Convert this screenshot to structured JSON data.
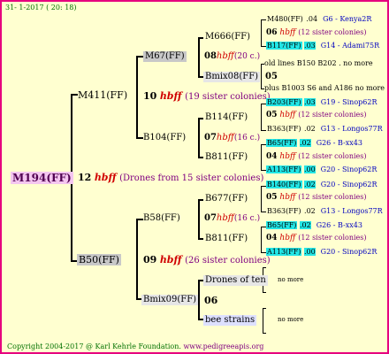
{
  "header": {
    "date": "31- 1-2017 ( 20: 18)"
  },
  "footer": {
    "copyright": "Copyright 2004-2017 @ Karl Kehrle Foundation.",
    "site": "www.pedigreeapis.org"
  },
  "root": {
    "name": "M194(FF)"
  },
  "gen1": {
    "num": "12",
    "hbff": "hbff",
    "note": "(Drones from 15 sister colonies)"
  },
  "sire": {
    "name": "M411(FF)",
    "num": "10",
    "hbff": "hbff",
    "note": "(19 sister colonies)"
  },
  "dam": {
    "name": "B50(FF)",
    "num": "09",
    "hbff": "hbff",
    "note": "(26 sister colonies)"
  },
  "m67": {
    "name": "M67(FF)",
    "num": "08",
    "hbff": "hbff",
    "note": "(20 c.)"
  },
  "b104": {
    "name": "B104(FF)",
    "num": "07",
    "hbff": "hbff",
    "note": "(16 c.)"
  },
  "b58": {
    "name": "B58(FF)",
    "num": "07",
    "hbff": "hbff",
    "note": "(16 c.)"
  },
  "bmix09": {
    "name": "Bmix09(FF)",
    "num": "06"
  },
  "m666": {
    "name": "M666(FF)",
    "num": "06",
    "hbff": "hbff",
    "note": "(12 sister colonies)"
  },
  "bmix08": {
    "name": "Bmix08(FF)",
    "num": "05"
  },
  "b114": {
    "name": "B114(FF)",
    "num": "05",
    "hbff": "hbff",
    "note": "(12 sister colonies)"
  },
  "b811a": {
    "name": "B811(FF)",
    "num": "04",
    "hbff": "hbff",
    "note": "(12 sister colonies)"
  },
  "b677": {
    "name": "B677(FF)",
    "num": "05",
    "hbff": "hbff",
    "note": "(12 sister colonies)"
  },
  "b811b": {
    "name": "B811(FF)",
    "num": "04",
    "hbff": "hbff",
    "note": "(12 sister colonies)"
  },
  "drones": {
    "label": "Drones of ten",
    "more": "no more"
  },
  "bees": {
    "label": "bee strains",
    "more": "no more"
  },
  "old_lines": {
    "text": "old lines B150 B202 . no more"
  },
  "plus_line": {
    "text": "plus B1003 S6 and A186",
    "more": "no more"
  },
  "g5": [
    {
      "name": "M480(FF)",
      "num": ".04",
      "place": "G6 - Kenya2R",
      "style": "plain"
    },
    {
      "name": "B117(FF)",
      "num": ".03",
      "place": "G14 - Adami75R",
      "style": "cyan"
    },
    {
      "name": "B203(FF)",
      "num": ".03",
      "place": "G19 - Sinop62R",
      "style": "cyan"
    },
    {
      "name": "B363(FF)",
      "num": ".02",
      "place": "G13 - Longos77R",
      "style": "plain"
    },
    {
      "name": "B65(FF)",
      "num": ".02",
      "place": "G26 - B-xx43",
      "style": "cyan"
    },
    {
      "name": "A113(FF)",
      "num": ".00",
      "place": "G20 - Sinop62R",
      "style": "cyan"
    },
    {
      "name": "B140(FF)",
      "num": ".02",
      "place": "G20 - Sinop62R",
      "style": "cyan"
    },
    {
      "name": "B363(FF)",
      "num": ".02",
      "place": "G13 - Longos77R",
      "style": "plain"
    },
    {
      "name": "B65(FF)",
      "num": ".02",
      "place": "G26 - B-xx43",
      "style": "cyan"
    },
    {
      "name": "A113(FF)",
      "num": ".00",
      "place": "G20 - Sinop62R",
      "style": "cyan"
    }
  ]
}
